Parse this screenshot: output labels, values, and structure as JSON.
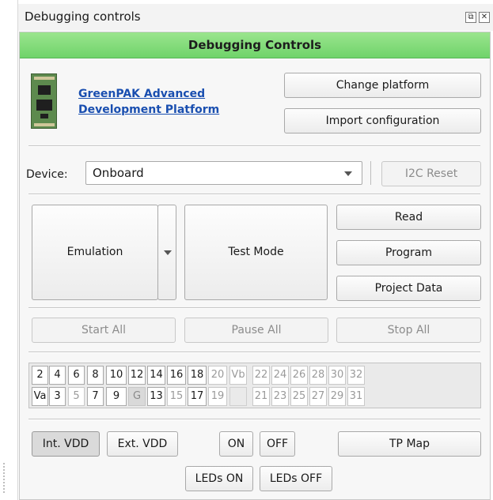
{
  "window": {
    "title": "Debugging controls"
  },
  "panel": {
    "header": "Debugging Controls",
    "platform_link": "GreenPAK Advanced Development Platform",
    "change_platform": "Change platform",
    "import_configuration": "Import configuration",
    "device_label": "Device:",
    "device_value": "Onboard",
    "i2c_reset": "I2C Reset",
    "emulation": "Emulation",
    "test_mode": "Test Mode",
    "read": "Read",
    "program": "Program",
    "project_data": "Project Data",
    "start_all": "Start All",
    "pause_all": "Pause All",
    "stop_all": "Stop All",
    "pins_top": [
      "2",
      "4",
      "6",
      "8",
      "10",
      "12",
      "14",
      "16",
      "18",
      "20",
      "Vb",
      "22",
      "24",
      "26",
      "28",
      "30",
      "32"
    ],
    "pins_bottom": [
      "Va",
      "3",
      "5",
      "7",
      "9",
      "G",
      "13",
      "15",
      "17",
      "19",
      "",
      "21",
      "23",
      "25",
      "27",
      "29",
      "31"
    ],
    "int_vdd": "Int. VDD",
    "ext_vdd": "Ext. VDD",
    "on": "ON",
    "off": "OFF",
    "tp_map": "TP Map",
    "leds_on": "LEDs ON",
    "leds_off": "LEDs OFF"
  },
  "colors": {
    "header_green": "#7edb74",
    "link_blue": "#1a4fb0",
    "disabled_text": "#8c8c8c"
  }
}
